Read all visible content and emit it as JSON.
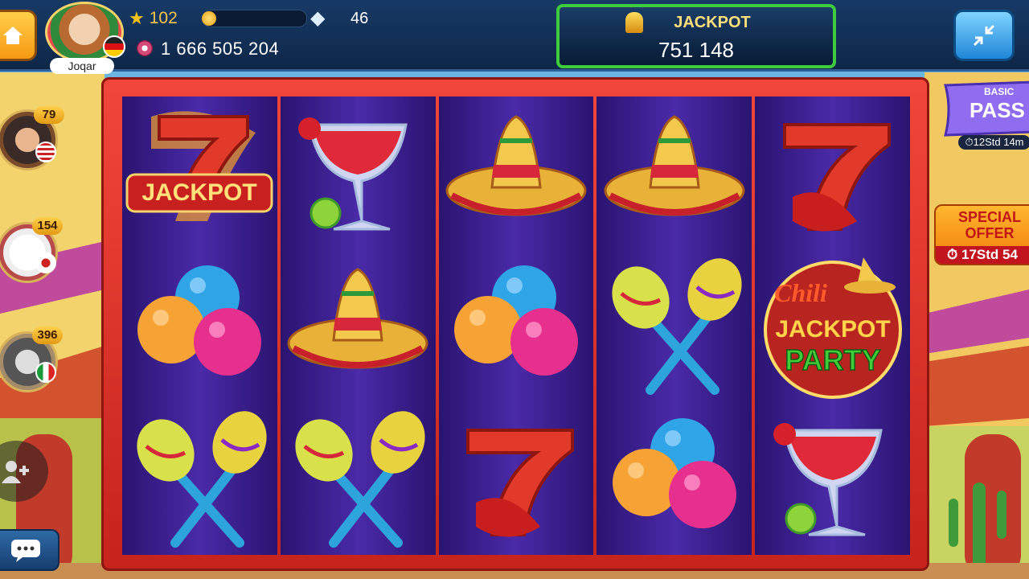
{
  "player": {
    "name": "Joqar",
    "level": "102",
    "gems": "46",
    "coins": "1 666 505 204"
  },
  "jackpot": {
    "title": "JACKPOT",
    "value": "751 148"
  },
  "side_players": [
    {
      "level": "79",
      "flag": "us"
    },
    {
      "level": "154",
      "flag": "jp"
    },
    {
      "level": "396",
      "flag": "it"
    }
  ],
  "basic_pass": {
    "label_small": "BASIC",
    "label_big": "PASS",
    "timer": "12Std 14m"
  },
  "special_offer": {
    "label": "SPECIAL OFFER",
    "timer": "17Std 54"
  },
  "reels": [
    [
      "jackpot-seven",
      "balloons",
      "maracas"
    ],
    [
      "margarita",
      "sombrero",
      "maracas"
    ],
    [
      "sombrero",
      "balloons",
      "red-seven"
    ],
    [
      "sombrero",
      "maracas",
      "balloons"
    ],
    [
      "red-seven",
      "chili-jackpot-party",
      "margarita"
    ]
  ],
  "symbol_text": {
    "jackpot_word": "JACKPOT",
    "chili_line1": "Chili",
    "chili_line2": "JACKPOT",
    "chili_line3": "PARTY"
  },
  "colors": {
    "frame": "#e3332a",
    "reel_bg": "#3a1f8c",
    "jackpot_border": "#3ecb3e",
    "topbar": "#173a66"
  }
}
